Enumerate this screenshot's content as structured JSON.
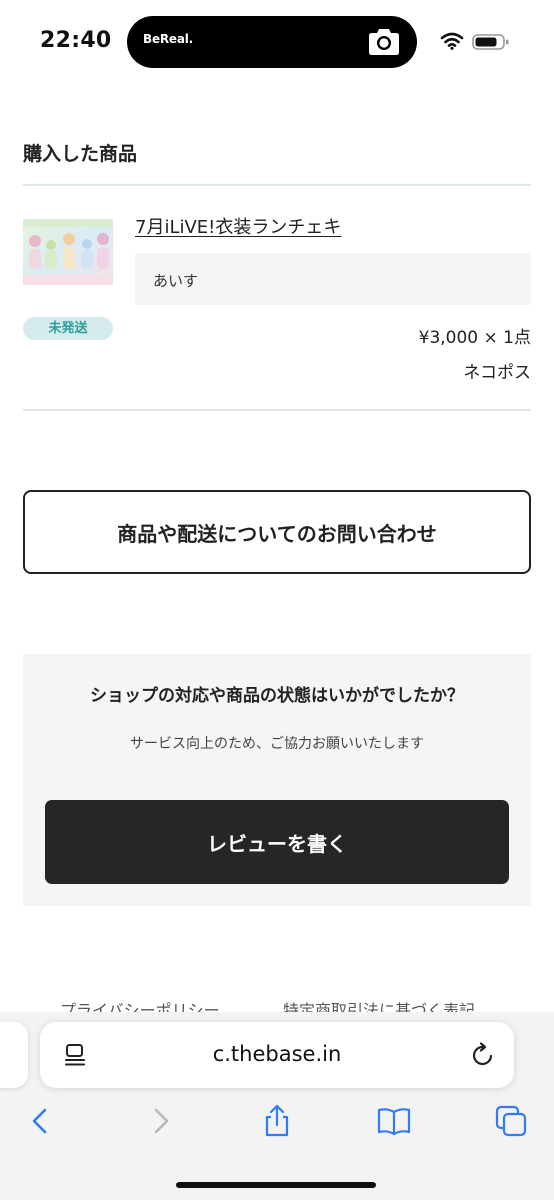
{
  "status_bar": {
    "time": "22:40",
    "island_app": "BeReal.",
    "island_icon": "camera-icon",
    "wifi_icon": "wifi-icon",
    "battery_icon": "battery-icon"
  },
  "purchased": {
    "section_title": "購入した商品",
    "item": {
      "thumbnail_icon": "product-photo",
      "title": "7月iLiVE!衣装ランチェキ",
      "option": "あいす",
      "status": "未発送",
      "price_qty": "¥3,000 × 1点",
      "shipping": "ネコポス"
    }
  },
  "inquiry": {
    "button_label": "商品や配送についてのお問い合わせ"
  },
  "review": {
    "heading": "ショップの対応や商品の状態はいかがでしたか？",
    "subtext": "サービス向上のため、ご協力お願いいたします",
    "button_label": "レビューを書く"
  },
  "footer": {
    "links": [
      "プライバシーポリシー",
      "特定商取引法に基づく表記"
    ]
  },
  "browser": {
    "url": "c.thebase.in",
    "toolbar": [
      {
        "name": "back",
        "icon": "chevron-left-icon"
      },
      {
        "name": "forward",
        "icon": "chevron-right-icon"
      },
      {
        "name": "share",
        "icon": "share-icon"
      },
      {
        "name": "bookmarks",
        "icon": "book-icon"
      },
      {
        "name": "tabs",
        "icon": "tabs-icon"
      }
    ]
  },
  "colors": {
    "accent_blue": "#2f7cf6",
    "badge_bg": "#d6ecec",
    "badge_text": "#2a9d9b",
    "review_button_bg": "#262626"
  }
}
